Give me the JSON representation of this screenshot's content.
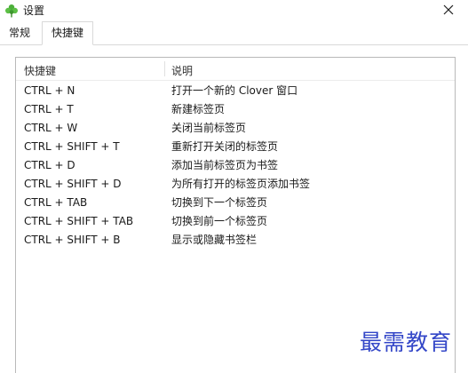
{
  "window": {
    "title": "设置",
    "close_symbol": "✕"
  },
  "tabs": [
    {
      "label": "常规",
      "active": false
    },
    {
      "label": "快捷键",
      "active": true
    }
  ],
  "table": {
    "columns": [
      "快捷键",
      "说明"
    ],
    "rows": [
      {
        "key": "CTRL + N",
        "desc": "打开一个新的 Clover 窗口"
      },
      {
        "key": "CTRL + T",
        "desc": "新建标签页"
      },
      {
        "key": "CTRL + W",
        "desc": "关闭当前标签页"
      },
      {
        "key": "CTRL + SHIFT + T",
        "desc": "重新打开关闭的标签页"
      },
      {
        "key": "CTRL + D",
        "desc": "添加当前标签页为书签"
      },
      {
        "key": "CTRL + SHIFT + D",
        "desc": "为所有打开的标签页添加书签"
      },
      {
        "key": "CTRL + TAB",
        "desc": "切换到下一个标签页"
      },
      {
        "key": "CTRL + SHIFT + TAB",
        "desc": "切换到前一个标签页"
      },
      {
        "key": "CTRL + SHIFT + B",
        "desc": "显示或隐藏书签栏"
      }
    ]
  },
  "watermark": {
    "text": "最需教育",
    "color": "#3447c8"
  },
  "icons": {
    "app": "clover-icon",
    "close": "close-icon"
  },
  "colors": {
    "clover_green": "#4caf3a",
    "border": "#b9b9b9"
  }
}
